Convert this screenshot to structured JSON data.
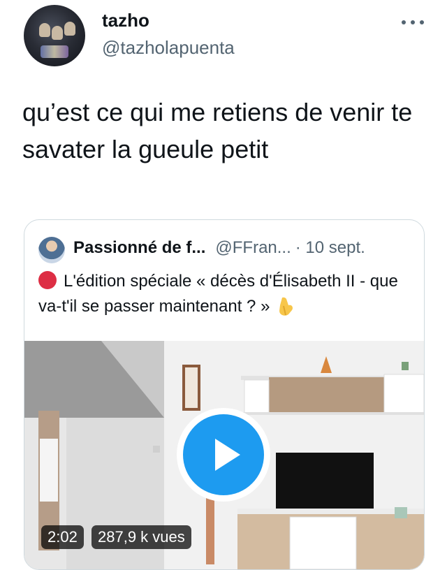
{
  "author": {
    "display_name": "tazho",
    "handle": "@tazholapuenta"
  },
  "icons": {
    "more": "more-horizontal-icon",
    "play": "play-icon",
    "red_circle": "red-circle-emoji",
    "pointing_down": "backhand-index-pointing-down-emoji"
  },
  "tweet": {
    "text": "qu’est ce qui me retiens de venir te savater la gueule petit"
  },
  "quoted": {
    "name": "Passionné de f...",
    "handle": "@FFran...",
    "date": "· 10 sept.",
    "text": "L'édition spéciale « décès d'Élisabeth II - que va-t'il se passer maintenant ? »"
  },
  "video": {
    "duration": "2:02",
    "views": "287,9 k vues"
  },
  "colors": {
    "accent": "#1d9bf0",
    "text": "#0f1419",
    "muted": "#536471",
    "border": "#cfd9de",
    "red_dot": "#dd2e44"
  }
}
